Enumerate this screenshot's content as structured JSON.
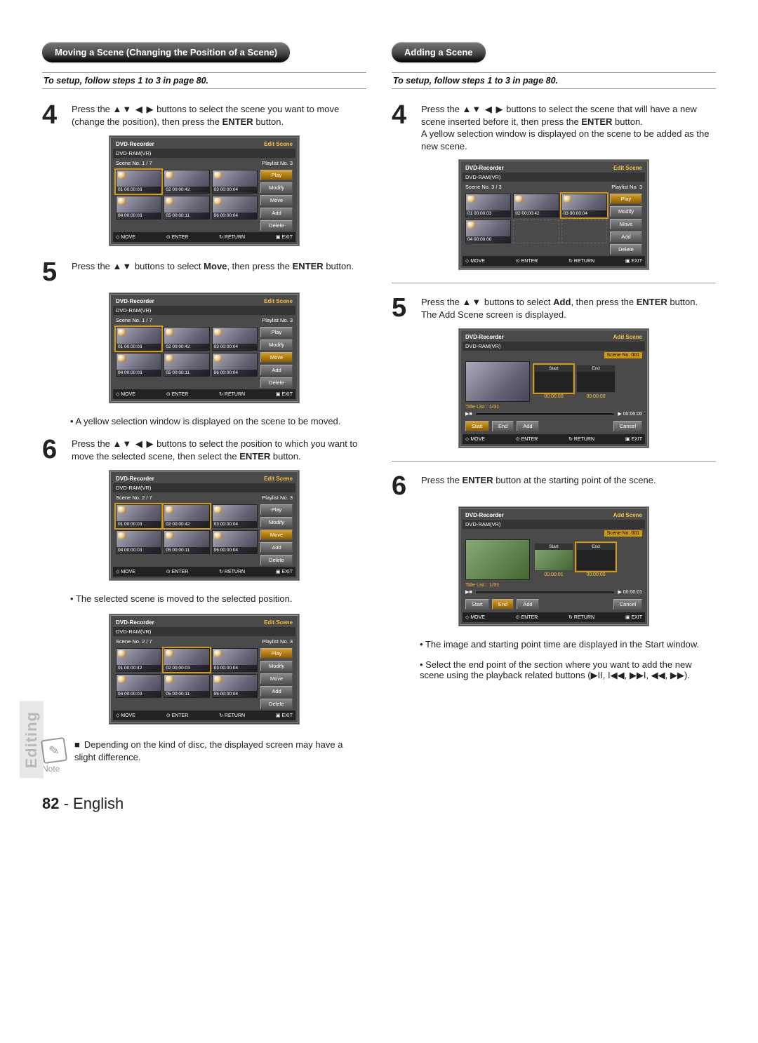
{
  "page_number": "82",
  "page_lang": "English",
  "side_tab": "Editing",
  "left": {
    "pill": "Moving a Scene (Changing the Position of a Scene)",
    "subbar": "To setup, follow steps 1 to 3 in page 80.",
    "step4_a": "Press the ",
    "step4_arrows": "▲▼ ◀ ▶",
    "step4_b": " buttons to select the scene you want to move (change the position), then press the ",
    "step4_c": "ENTER",
    "step4_d": " button.",
    "osd1": {
      "title_l": "DVD-Recorder",
      "title_r": "Edit Scene",
      "disc": "DVD-RAM(VR)",
      "scene": "Scene No.    1 / 7",
      "pl": "Playlist No.    3",
      "thumbs": [
        {
          "lbl": "01  00:00:03",
          "sel": true
        },
        {
          "lbl": "02  00:00:42"
        },
        {
          "lbl": "03  00:00:04"
        },
        {
          "lbl": "04  00:00:03"
        },
        {
          "lbl": "05  00:00:11"
        },
        {
          "lbl": "06  00:00:04"
        }
      ],
      "btns": [
        {
          "t": "Play",
          "sel": true
        },
        {
          "t": "Modify"
        },
        {
          "t": "Move"
        },
        {
          "t": "Add"
        },
        {
          "t": "Delete"
        }
      ],
      "foot": [
        "MOVE",
        "ENTER",
        "RETURN",
        "EXIT"
      ]
    },
    "step5_a": "Press the ",
    "step5_arrows": "▲▼",
    "step5_b": " buttons to select ",
    "step5_c": "Move",
    "step5_d": ", then press the ",
    "step5_e": "ENTER",
    "step5_f": " button.",
    "osd2": {
      "title_l": "DVD-Recorder",
      "title_r": "Edit Scene",
      "disc": "DVD-RAM(VR)",
      "scene": "Scene No.    1 / 7",
      "pl": "Playlist No.    3",
      "thumbs": [
        {
          "lbl": "01  00:00:03",
          "sel": true
        },
        {
          "lbl": "02  00:00:42"
        },
        {
          "lbl": "03  00:00:04"
        },
        {
          "lbl": "04  00:00:03"
        },
        {
          "lbl": "05  00:00:11"
        },
        {
          "lbl": "06  00:00:04"
        }
      ],
      "btns": [
        {
          "t": "Play"
        },
        {
          "t": "Modify"
        },
        {
          "t": "Move",
          "sel": true
        },
        {
          "t": "Add"
        },
        {
          "t": "Delete"
        }
      ],
      "foot": [
        "MOVE",
        "ENTER",
        "RETURN",
        "EXIT"
      ]
    },
    "bullet5": "A yellow selection window is displayed on the scene to be moved.",
    "step6_a": "Press the ",
    "step6_arrows": "▲▼ ◀ ▶",
    "step6_b": " buttons to select the position to which you want to move the selected scene, then select the ",
    "step6_c": "ENTER",
    "step6_d": " button.",
    "osd3": {
      "title_l": "DVD-Recorder",
      "title_r": "Edit Scene",
      "disc": "DVD-RAM(VR)",
      "scene": "Scene No.    2 / 7",
      "pl": "Playlist No.    3",
      "thumbs": [
        {
          "lbl": "01  00:00:03",
          "sel": true
        },
        {
          "lbl": "02  00:00:42",
          "sel": true
        },
        {
          "lbl": "03  00:00:04"
        },
        {
          "lbl": "04  00:00:03"
        },
        {
          "lbl": "05  00:00:11"
        },
        {
          "lbl": "06  00:00:04"
        }
      ],
      "btns": [
        {
          "t": "Play"
        },
        {
          "t": "Modify"
        },
        {
          "t": "Move",
          "sel": true
        },
        {
          "t": "Add"
        },
        {
          "t": "Delete"
        }
      ],
      "foot": [
        "MOVE",
        "ENTER",
        "RETURN",
        "EXIT"
      ]
    },
    "bullet6": "The selected scene is moved to the selected position.",
    "osd4": {
      "title_l": "DVD-Recorder",
      "title_r": "Edit Scene",
      "disc": "DVD-RAM(VR)",
      "scene": "Scene No.    2 / 7",
      "pl": "Playlist No.    3",
      "thumbs": [
        {
          "lbl": "01  00:00:42"
        },
        {
          "lbl": "02  00:00:03",
          "sel": true
        },
        {
          "lbl": "03  00:00:04"
        },
        {
          "lbl": "04  00:00:03"
        },
        {
          "lbl": "05  00:00:11"
        },
        {
          "lbl": "06  00:00:04"
        }
      ],
      "btns": [
        {
          "t": "Play",
          "sel": true
        },
        {
          "t": "Modify"
        },
        {
          "t": "Move"
        },
        {
          "t": "Add"
        },
        {
          "t": "Delete"
        }
      ],
      "foot": [
        "MOVE",
        "ENTER",
        "RETURN",
        "EXIT"
      ]
    },
    "note_label": "Note",
    "note_bullet": "■",
    "note_text": "Depending on the kind of disc, the displayed screen may have a slight difference."
  },
  "right": {
    "pill": "Adding a Scene",
    "subbar": "To setup, follow steps 1 to 3 in page 80.",
    "step4_a": "Press the ",
    "step4_arrows": "▲▼ ◀ ▶",
    "step4_b": " buttons to select the scene that will have a new scene inserted before it, then press the ",
    "step4_c": "ENTER",
    "step4_d": " button.",
    "step4_e": "A yellow selection window is displayed on the scene to be added as the new scene.",
    "osd1": {
      "title_l": "DVD-Recorder",
      "title_r": "Edit Scene",
      "disc": "DVD-RAM(VR)",
      "scene": "Scene No.    3 / 3",
      "pl": "Playlist No.    3",
      "thumbs": [
        {
          "lbl": "01  00:00:03"
        },
        {
          "lbl": "02  00:00:42"
        },
        {
          "lbl": "03  00:00:04",
          "sel": true
        },
        {
          "lbl": "04  00:00:00",
          "blank": false
        }
      ],
      "btns": [
        {
          "t": "Play",
          "sel": true
        },
        {
          "t": "Modify"
        },
        {
          "t": "Move"
        },
        {
          "t": "Add"
        },
        {
          "t": "Delete"
        }
      ],
      "foot": [
        "MOVE",
        "ENTER",
        "RETURN",
        "EXIT"
      ]
    },
    "step5_a": "Press the ",
    "step5_arrows": "▲▼",
    "step5_b": " buttons to select ",
    "step5_c": "Add",
    "step5_d": ", then press the ",
    "step5_e": "ENTER",
    "step5_f": " button.",
    "step5_g": "The Add Scene screen is displayed.",
    "osd2": {
      "title_l": "DVD-Recorder",
      "title_r": "Add Scene",
      "disc": "DVD-RAM(VR)",
      "sceneno": "Scene No. 001",
      "mini_l": "Start",
      "mini_r": "End",
      "title_list": "Title List : 1/31",
      "tc_l": "00:00:00",
      "tc_r": "00:00:00",
      "time_r": "00:00:00",
      "btns": [
        "Start",
        "End",
        "Add"
      ],
      "cancel": "Cancel",
      "foot": [
        "MOVE",
        "ENTER",
        "RETURN",
        "EXIT"
      ]
    },
    "step6_a": "Press the ",
    "step6_b": "ENTER",
    "step6_c": " button at the starting point of the scene.",
    "osd3": {
      "title_l": "DVD-Recorder",
      "title_r": "Add Scene",
      "disc": "DVD-RAM(VR)",
      "sceneno": "Scene No. 001",
      "mini_l": "Start",
      "mini_r": "End",
      "title_list": "Title List : 1/31",
      "tc_l": "00:00:01",
      "tc_r": "00:00:00",
      "time_r": "00:00:01",
      "btns": [
        "Start",
        "End",
        "Add"
      ],
      "cancel": "Cancel",
      "foot": [
        "MOVE",
        "ENTER",
        "RETURN",
        "EXIT"
      ]
    },
    "bulletA": "The image and starting point time are displayed in the Start window.",
    "bulletB_a": "Select the end point of the section where you want to add the new scene using the playback related buttons (",
    "bulletB_icons": "▶II, I◀◀, ▶▶I, ◀◀, ▶▶",
    "bulletB_b": ")."
  }
}
